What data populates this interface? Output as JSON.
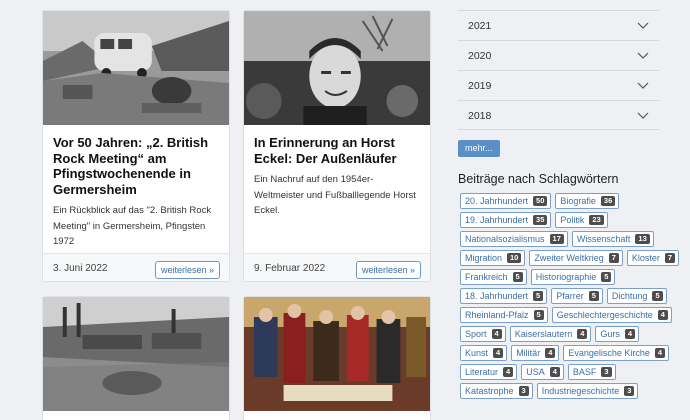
{
  "cards": [
    {
      "title": "Vor 50 Jahren: „2. British Rock Meeting“ am Pfingstwochenende in Germersheim",
      "excerpt": "Ein Rückblick auf das \"2. British Rock Meeting\" in Germersheim, Pfingsten 1972",
      "date": "3. Juni 2022",
      "more": "weiterlesen »"
    },
    {
      "title": "In Erinnerung an Horst Eckel: Der Außenläufer",
      "excerpt": "Ein Nachruf auf den 1954er-Weltmeister und Fußballlegende Horst Eckel.",
      "date": "9. Februar 2022",
      "more": "weiterlesen »"
    }
  ],
  "archive": {
    "years": [
      "2021",
      "2020",
      "2019",
      "2018"
    ],
    "more_label": "mehr..."
  },
  "tags_title": "Beiträge nach Schlagwörtern",
  "tags": [
    {
      "label": "20. Jahrhundert",
      "count": "50"
    },
    {
      "label": "Biografie",
      "count": "36"
    },
    {
      "label": "19. Jahrhundert",
      "count": "35"
    },
    {
      "label": "Politik",
      "count": "23"
    },
    {
      "label": "Nationalsozialismus",
      "count": "17"
    },
    {
      "label": "Wissenschaft",
      "count": "13"
    },
    {
      "label": "Migration",
      "count": "10"
    },
    {
      "label": "Zweiter Weltkrieg",
      "count": "7"
    },
    {
      "label": "Kloster",
      "count": "7"
    },
    {
      "label": "Frankreich",
      "count": "5"
    },
    {
      "label": "Historiographie",
      "count": "5"
    },
    {
      "label": "18. Jahrhundert",
      "count": "5"
    },
    {
      "label": "Pfarrer",
      "count": "5"
    },
    {
      "label": "Dichtung",
      "count": "5"
    },
    {
      "label": "Rheinland-Pfalz",
      "count": "5"
    },
    {
      "label": "Geschlechtergeschichte",
      "count": "4"
    },
    {
      "label": "Sport",
      "count": "4"
    },
    {
      "label": "Kaiserslautern",
      "count": "4"
    },
    {
      "label": "Gurs",
      "count": "4"
    },
    {
      "label": "Kunst",
      "count": "4"
    },
    {
      "label": "Militär",
      "count": "4"
    },
    {
      "label": "Evangelische Kirche",
      "count": "4"
    },
    {
      "label": "Literatur",
      "count": "4"
    },
    {
      "label": "USA",
      "count": "4"
    },
    {
      "label": "BASF",
      "count": "3"
    },
    {
      "label": "Katastrophe",
      "count": "3"
    },
    {
      "label": "Industriegeschichte",
      "count": "3"
    }
  ]
}
